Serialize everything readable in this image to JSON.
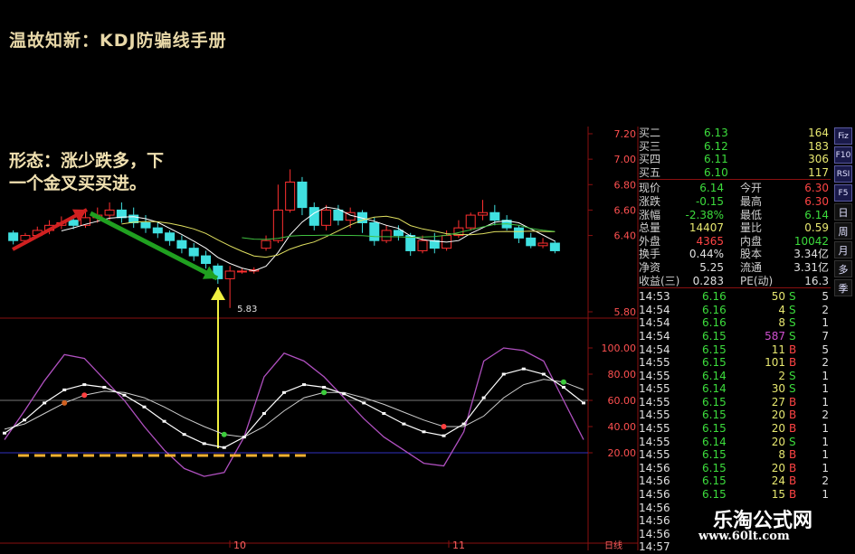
{
  "page": {
    "title": "温故知新：KDJ防骗线手册",
    "annotation": [
      "形态：涨少跌多，下",
      "一个金叉买买进。"
    ],
    "low_label": "5.83",
    "period_label": "日线",
    "date_marks": [
      "10",
      "11"
    ],
    "watermark": "乐淘公式网",
    "watermark_url": "www.60lt.com"
  },
  "price_axis": [
    "7.20",
    "7.00",
    "6.80",
    "6.60",
    "6.40",
    "5.80"
  ],
  "kdj_axis": [
    "100.00",
    "80.00",
    "60.00",
    "40.00",
    "20.00"
  ],
  "order_book": [
    {
      "label": "买二",
      "price": "6.13",
      "vol": "164"
    },
    {
      "label": "买三",
      "price": "6.12",
      "vol": "183"
    },
    {
      "label": "买四",
      "price": "6.11",
      "vol": "306"
    },
    {
      "label": "买五",
      "price": "6.10",
      "vol": "117"
    }
  ],
  "stats": [
    {
      "l1": "现价",
      "v1": "6.14",
      "c1": "green",
      "l2": "今开",
      "v2": "6.30",
      "c2": "red"
    },
    {
      "l1": "涨跌",
      "v1": "-0.15",
      "c1": "green",
      "l2": "最高",
      "v2": "6.30",
      "c2": "red"
    },
    {
      "l1": "涨幅",
      "v1": "-2.38%",
      "c1": "green",
      "l2": "最低",
      "v2": "6.14",
      "c2": "green"
    },
    {
      "l1": "总量",
      "v1": "14407",
      "c1": "yel",
      "l2": "量比",
      "v2": "0.59",
      "c2": "yel"
    },
    {
      "l1": "外盘",
      "v1": "4365",
      "c1": "red",
      "l2": "内盘",
      "v2": "10042",
      "c2": "green"
    },
    {
      "l1": "换手",
      "v1": "0.44%",
      "c1": "wht",
      "l2": "股本",
      "v2": "3.34亿",
      "c2": "wht"
    },
    {
      "l1": "净资",
      "v1": "5.25",
      "c1": "wht",
      "l2": "流通",
      "v2": "3.31亿",
      "c2": "wht"
    },
    {
      "l1": "收益(三)",
      "v1": "0.283",
      "c1": "wht",
      "l2": "PE(动)",
      "v2": "16.3",
      "c2": "wht"
    }
  ],
  "ticks": [
    {
      "time": "14:53",
      "price": "6.16",
      "vol": "50",
      "dir": "S",
      "n": "5"
    },
    {
      "time": "14:54",
      "price": "6.16",
      "vol": "4",
      "dir": "S",
      "n": "2"
    },
    {
      "time": "14:54",
      "price": "6.16",
      "vol": "8",
      "dir": "S",
      "n": "1"
    },
    {
      "time": "14:54",
      "price": "6.15",
      "vol": "587",
      "dir": "S",
      "n": "7"
    },
    {
      "time": "14:54",
      "price": "6.15",
      "vol": "11",
      "dir": "B",
      "n": "5"
    },
    {
      "time": "14:55",
      "price": "6.15",
      "vol": "101",
      "dir": "B",
      "n": "2"
    },
    {
      "time": "14:55",
      "price": "6.14",
      "vol": "2",
      "dir": "S",
      "n": "1"
    },
    {
      "time": "14:55",
      "price": "6.14",
      "vol": "30",
      "dir": "S",
      "n": "1"
    },
    {
      "time": "14:55",
      "price": "6.15",
      "vol": "27",
      "dir": "B",
      "n": "1"
    },
    {
      "time": "14:55",
      "price": "6.15",
      "vol": "20",
      "dir": "B",
      "n": "2"
    },
    {
      "time": "14:55",
      "price": "6.15",
      "vol": "20",
      "dir": "B",
      "n": "1"
    },
    {
      "time": "14:55",
      "price": "6.14",
      "vol": "20",
      "dir": "S",
      "n": "1"
    },
    {
      "time": "14:55",
      "price": "6.15",
      "vol": "8",
      "dir": "B",
      "n": "1"
    },
    {
      "time": "14:56",
      "price": "6.15",
      "vol": "20",
      "dir": "B",
      "n": "1"
    },
    {
      "time": "14:56",
      "price": "6.15",
      "vol": "24",
      "dir": "B",
      "n": "2"
    },
    {
      "time": "14:56",
      "price": "6.15",
      "vol": "15",
      "dir": "B",
      "n": "1"
    },
    {
      "time": "14:56",
      "price": "",
      "vol": "",
      "dir": "",
      "n": ""
    },
    {
      "time": "14:56",
      "price": "",
      "vol": "",
      "dir": "",
      "n": ""
    },
    {
      "time": "14:56",
      "price": "",
      "vol": "",
      "dir": "",
      "n": ""
    },
    {
      "time": "14:57",
      "price": "",
      "vol": "",
      "dir": "",
      "n": ""
    }
  ],
  "sidebar": [
    "Fiz",
    "F10",
    "RSI",
    "F5",
    "日",
    "周",
    "月",
    "多",
    "季"
  ],
  "colors": {
    "up": "#ff3030",
    "down": "#40e0e0",
    "k": "#ffffff",
    "j": "#b050c0",
    "accent": "#e8e870"
  },
  "chart_data": {
    "type": "candlestick",
    "candles": [
      {
        "o": 6.42,
        "c": 6.36,
        "h": 6.44,
        "l": 6.33
      },
      {
        "o": 6.36,
        "c": 6.4,
        "h": 6.42,
        "l": 6.34
      },
      {
        "o": 6.4,
        "c": 6.44,
        "h": 6.47,
        "l": 6.38
      },
      {
        "o": 6.44,
        "c": 6.48,
        "h": 6.52,
        "l": 6.41
      },
      {
        "o": 6.48,
        "c": 6.5,
        "h": 6.55,
        "l": 6.45
      },
      {
        "o": 6.52,
        "c": 6.48,
        "h": 6.56,
        "l": 6.45
      },
      {
        "o": 6.48,
        "c": 6.54,
        "h": 6.6,
        "l": 6.46
      },
      {
        "o": 6.54,
        "c": 6.56,
        "h": 6.62,
        "l": 6.5
      },
      {
        "o": 6.56,
        "c": 6.6,
        "h": 6.66,
        "l": 6.52
      },
      {
        "o": 6.6,
        "c": 6.54,
        "h": 6.66,
        "l": 6.5
      },
      {
        "o": 6.56,
        "c": 6.5,
        "h": 6.62,
        "l": 6.46
      },
      {
        "o": 6.5,
        "c": 6.46,
        "h": 6.56,
        "l": 6.42
      },
      {
        "o": 6.46,
        "c": 6.42,
        "h": 6.5,
        "l": 6.38
      },
      {
        "o": 6.42,
        "c": 6.36,
        "h": 6.44,
        "l": 6.32
      },
      {
        "o": 6.36,
        "c": 6.3,
        "h": 6.4,
        "l": 6.26
      },
      {
        "o": 6.3,
        "c": 6.24,
        "h": 6.34,
        "l": 6.2
      },
      {
        "o": 6.24,
        "c": 6.18,
        "h": 6.28,
        "l": 6.14
      },
      {
        "o": 6.16,
        "c": 6.06,
        "h": 6.18,
        "l": 6.02
      },
      {
        "o": 6.06,
        "c": 6.12,
        "h": 6.16,
        "l": 5.83
      },
      {
        "o": 6.12,
        "c": 6.12,
        "h": 6.14,
        "l": 6.1
      },
      {
        "o": 6.12,
        "c": 6.13,
        "h": 6.15,
        "l": 6.1
      },
      {
        "o": 6.3,
        "c": 6.36,
        "h": 6.4,
        "l": 6.28
      },
      {
        "o": 6.36,
        "c": 6.6,
        "h": 6.8,
        "l": 6.34
      },
      {
        "o": 6.6,
        "c": 6.82,
        "h": 6.92,
        "l": 6.58
      },
      {
        "o": 6.82,
        "c": 6.62,
        "h": 6.86,
        "l": 6.56
      },
      {
        "o": 6.62,
        "c": 6.48,
        "h": 6.66,
        "l": 6.44
      },
      {
        "o": 6.48,
        "c": 6.6,
        "h": 6.64,
        "l": 6.44
      },
      {
        "o": 6.6,
        "c": 6.52,
        "h": 6.64,
        "l": 6.48
      },
      {
        "o": 6.52,
        "c": 6.58,
        "h": 6.62,
        "l": 6.46
      },
      {
        "o": 6.58,
        "c": 6.5,
        "h": 6.6,
        "l": 6.42
      },
      {
        "o": 6.5,
        "c": 6.36,
        "h": 6.54,
        "l": 6.32
      },
      {
        "o": 6.36,
        "c": 6.44,
        "h": 6.48,
        "l": 6.34
      },
      {
        "o": 6.44,
        "c": 6.4,
        "h": 6.48,
        "l": 6.36
      },
      {
        "o": 6.4,
        "c": 6.28,
        "h": 6.42,
        "l": 6.24
      },
      {
        "o": 6.28,
        "c": 6.36,
        "h": 6.4,
        "l": 6.26
      },
      {
        "o": 6.36,
        "c": 6.3,
        "h": 6.42,
        "l": 6.26
      },
      {
        "o": 6.3,
        "c": 6.4,
        "h": 6.44,
        "l": 6.28
      },
      {
        "o": 6.4,
        "c": 6.46,
        "h": 6.52,
        "l": 6.38
      },
      {
        "o": 6.46,
        "c": 6.56,
        "h": 6.58,
        "l": 6.44
      },
      {
        "o": 6.56,
        "c": 6.58,
        "h": 6.68,
        "l": 6.52
      },
      {
        "o": 6.58,
        "c": 6.52,
        "h": 6.64,
        "l": 6.48
      },
      {
        "o": 6.52,
        "c": 6.46,
        "h": 6.56,
        "l": 6.44
      },
      {
        "o": 6.46,
        "c": 6.38,
        "h": 6.48,
        "l": 6.34
      },
      {
        "o": 6.38,
        "c": 6.32,
        "h": 6.42,
        "l": 6.3
      },
      {
        "o": 6.32,
        "c": 6.34,
        "h": 6.38,
        "l": 6.3
      },
      {
        "o": 6.34,
        "c": 6.28,
        "h": 6.36,
        "l": 6.26
      }
    ],
    "kdj": {
      "k": [
        35,
        45,
        58,
        68,
        72,
        70,
        64,
        55,
        44,
        34,
        27,
        24,
        32,
        50,
        66,
        72,
        70,
        65,
        58,
        50,
        42,
        36,
        33,
        42,
        62,
        80,
        84,
        80,
        70,
        58
      ],
      "d": [
        38,
        42,
        50,
        58,
        64,
        67,
        66,
        62,
        55,
        47,
        40,
        34,
        32,
        40,
        52,
        62,
        66,
        66,
        62,
        57,
        51,
        45,
        40,
        40,
        48,
        62,
        72,
        76,
        74,
        68
      ],
      "j": [
        30,
        52,
        75,
        95,
        92,
        76,
        60,
        40,
        22,
        8,
        2,
        5,
        32,
        78,
        96,
        90,
        78,
        62,
        46,
        32,
        22,
        12,
        10,
        36,
        90,
        100,
        98,
        90,
        60,
        30
      ]
    },
    "ylim_price": [
      5.8,
      7.2
    ],
    "ylim_kdj": [
      0,
      100
    ]
  }
}
